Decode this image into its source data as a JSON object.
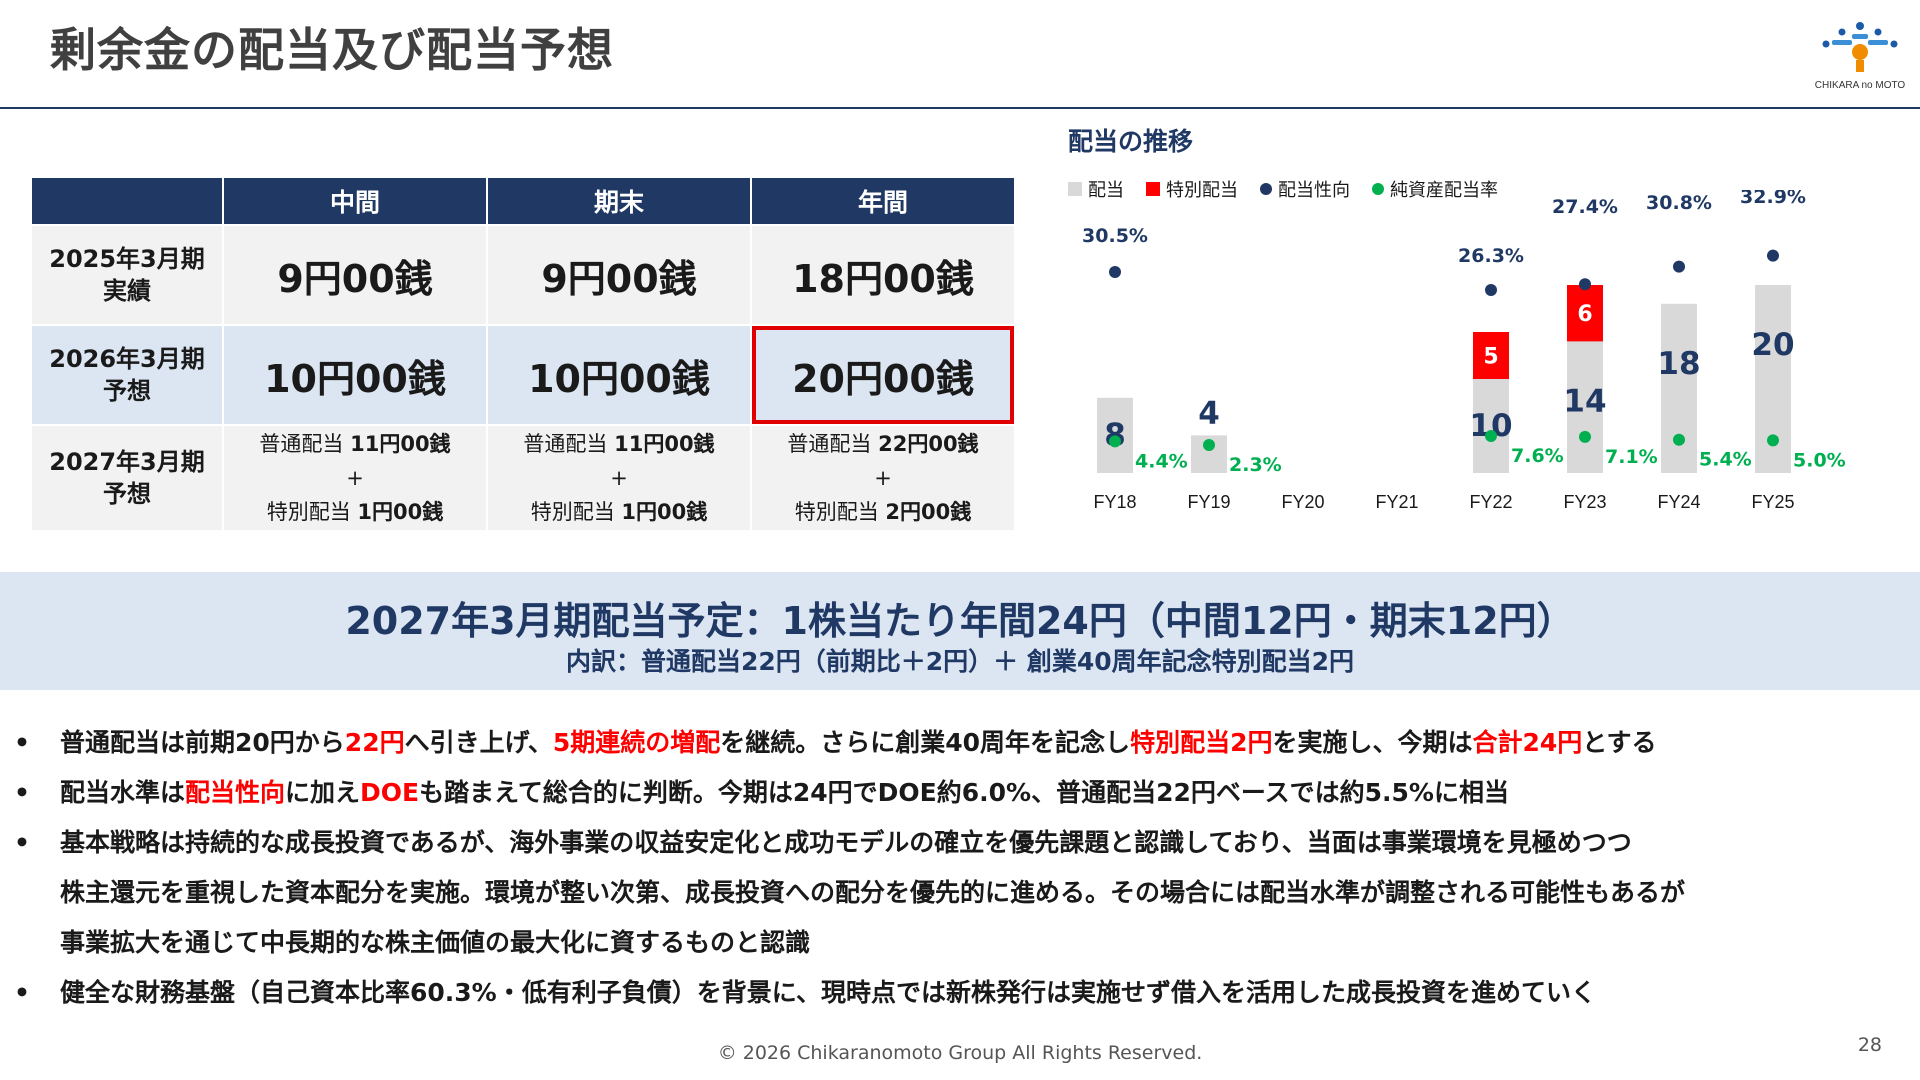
{
  "title": "剰余金の配当及び配当予想",
  "logo": {
    "text": "CHIKARA no MOTO"
  },
  "table": {
    "headers": [
      "中間",
      "期末",
      "年間"
    ],
    "rows": [
      {
        "label1": "2025年3月期",
        "label2": "実績",
        "cells": [
          "9円00銭",
          "9円00銭",
          "18円00銭"
        ]
      },
      {
        "label1": "2026年3月期",
        "label2": "予想",
        "cells": [
          "10円00銭",
          "10円00銭",
          "20円00銭"
        ]
      },
      {
        "label1": "2027年3月期",
        "label2": "予想",
        "cells": [
          {
            "a": "普通配当",
            "b": "11円00銭",
            "plus": "+",
            "c": "特別配当",
            "d": "1円00銭"
          },
          {
            "a": "普通配当",
            "b": "11円00銭",
            "plus": "+",
            "c": "特別配当",
            "d": "1円00銭"
          },
          {
            "a": "普通配当",
            "b": "22円00銭",
            "plus": "+",
            "c": "特別配当",
            "d": "2円00銭"
          }
        ]
      }
    ]
  },
  "chart_data": {
    "type": "bar",
    "title": "配当の推移",
    "legend": [
      "配当",
      "特別配当",
      "配当性向",
      "純資産配当率"
    ],
    "legend_position": "top-left",
    "colors": {
      "dividend": "#d9d9d9",
      "special": "#ff0000",
      "payout": "#1f3864",
      "doe": "#00b050"
    },
    "categories": [
      "FY18",
      "FY19",
      "FY20",
      "FY21",
      "FY22",
      "FY23",
      "FY24",
      "FY25"
    ],
    "series": [
      {
        "name": "配当",
        "values": [
          8,
          4,
          null,
          null,
          10,
          14,
          18,
          20
        ]
      },
      {
        "name": "特別配当",
        "values": [
          null,
          null,
          null,
          null,
          5,
          6,
          null,
          null
        ]
      },
      {
        "name": "配当性向",
        "values": [
          30.5,
          null,
          null,
          null,
          26.3,
          27.4,
          30.8,
          32.9
        ],
        "labels": [
          "30.5%",
          "",
          "",
          "",
          "26.3%",
          "27.4%",
          "30.8%",
          "32.9%"
        ]
      },
      {
        "name": "純資産配当率",
        "values": [
          4.4,
          2.3,
          null,
          null,
          7.6,
          7.1,
          5.4,
          5.0
        ],
        "labels": [
          "4.4%",
          "2.3%",
          "",
          "",
          "7.6%",
          "7.1%",
          "5.4%",
          "5.0%"
        ]
      }
    ]
  },
  "banner": {
    "main": "2027年3月期配当予定：1株当たり年間24円（中間12円・期末12円）",
    "sub": "内訳：普通配当22円（前期比＋2円）＋ 創業40周年記念特別配当2円"
  },
  "bullets": {
    "b1": [
      "普通配当は前期20円から",
      "22円",
      "へ引き上げ、",
      "5期連続の増配",
      "を継続。さらに創業40周年を記念し",
      "特別配当2円",
      "を実施し、今期は",
      "合計24円",
      "とする"
    ],
    "b2": [
      "配当水準は",
      "配当性向",
      "に加え",
      "DOE",
      "も踏まえて総合的に判断。今期は24円でDOE約6.0%、普通配当22円ベースでは約5.5%に相当"
    ],
    "b3": [
      "基本戦略は持続的な成長投資であるが、海外事業の収益安定化と成功モデルの確立を優先課題と認識しており、当面は事業環境を見極めつつ",
      "株主還元を重視した資本配分を実施。環境が整い次第、成長投資への配分を優先的に進める。その場合には配当水準が調整される可能性もあるが",
      "事業拡大を通じて中長期的な株主価値の最大化に資するものと認識"
    ],
    "b4": "健全な財務基盤（自己資本比率60.3%・低有利子負債）を背景に、現時点では新株発行は実施せず借入を活用した成長投資を進めていく"
  },
  "footer": "© 2026 Chikaranomoto Group All Rights Reserved.",
  "page_number": "28"
}
